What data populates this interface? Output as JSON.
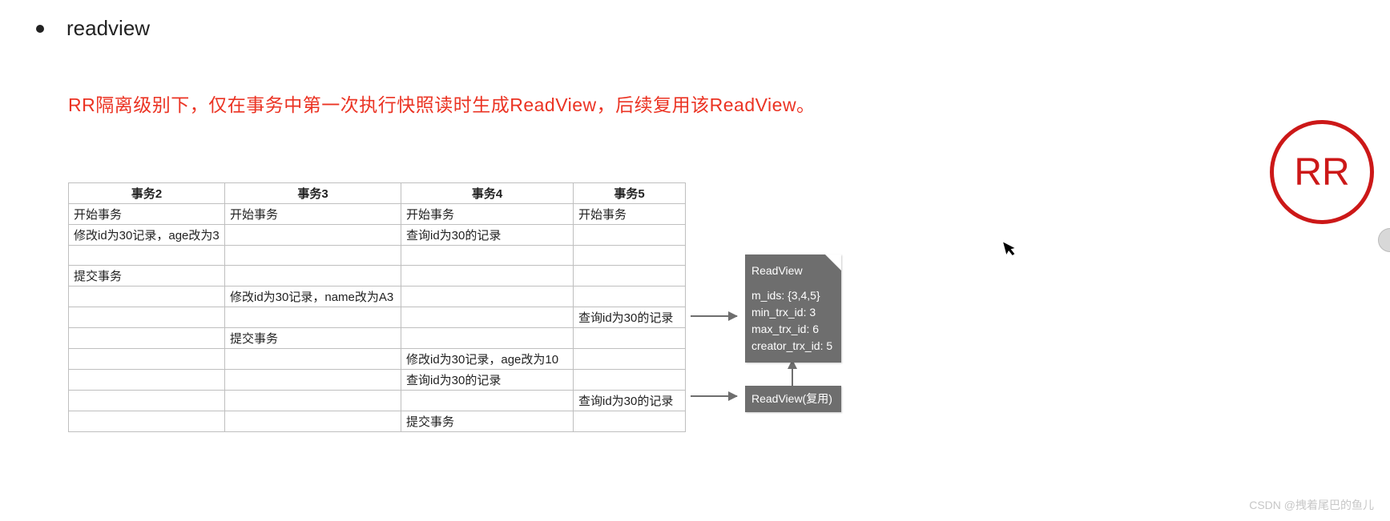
{
  "heading": "readview",
  "description": "RR隔离级别下，仅在事务中第一次执行快照读时生成ReadView，后续复用该ReadView。",
  "table": {
    "headers": [
      "事务2",
      "事务3",
      "事务4",
      "事务5"
    ],
    "rows": [
      [
        "开始事务",
        "开始事务",
        "开始事务",
        "开始事务"
      ],
      [
        "修改id为30记录，age改为3",
        "",
        "查询id为30的记录",
        ""
      ],
      [
        "",
        "",
        "",
        ""
      ],
      [
        "提交事务",
        "",
        "",
        ""
      ],
      [
        "",
        "修改id为30记录，name改为A3",
        "",
        ""
      ],
      [
        "",
        "",
        "",
        "查询id为30的记录"
      ],
      [
        "",
        "提交事务",
        "",
        ""
      ],
      [
        "",
        "",
        "修改id为30记录，age改为10",
        ""
      ],
      [
        "",
        "",
        "查询id为30的记录",
        ""
      ],
      [
        "",
        "",
        "",
        "查询id为30的记录"
      ],
      [
        "",
        "",
        "提交事务",
        ""
      ]
    ]
  },
  "readview1": {
    "title": "ReadView",
    "lines": [
      "m_ids: {3,4,5}",
      "min_trx_id: 3",
      "max_trx_id: 6",
      "creator_trx_id: 5"
    ]
  },
  "readview2": {
    "title": "ReadView(复用)"
  },
  "badge": "RR",
  "watermark": "CSDN @拽着尾巴的鱼儿"
}
